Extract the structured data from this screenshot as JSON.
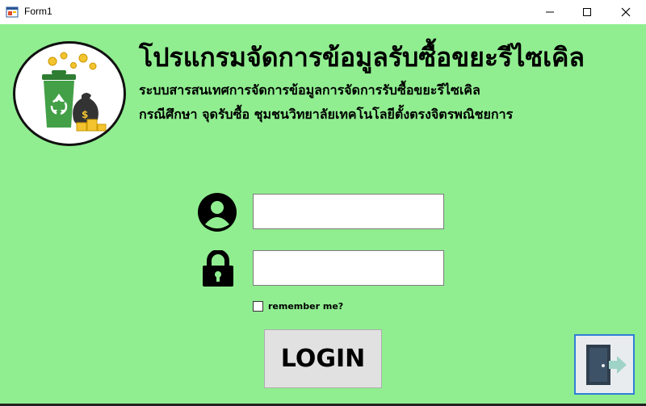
{
  "window": {
    "title": "Form1",
    "controls": [
      "minimize-icon",
      "maximize-icon",
      "close-icon"
    ]
  },
  "header": {
    "title": "โปรแกรมจัดการข้อมูลรับซื้อขยะรีไซเคิล",
    "subtitle_line1": "ระบบสารสนเทศการจัดการข้อมูลการจัดการรับซื้อขยะรีไซเคิล",
    "subtitle_line2": "กรณีศึกษา จุดรับซื้อ ชุมชนวิทยาลัยเทคโนโลยีตั้งตรงจิตรพณิชยการ"
  },
  "form": {
    "username_value": "",
    "password_value": "",
    "username_icon": "user-circle-icon",
    "password_icon": "lock-icon",
    "remember_label": "remember me?",
    "remember_checked": false,
    "login_label": "LOGIN"
  },
  "footer": {
    "exit_icon": "exit-door-icon"
  },
  "colors": {
    "background": "#90ee90",
    "button": "#e1e1e1",
    "accent_border": "#2f7fd6"
  }
}
